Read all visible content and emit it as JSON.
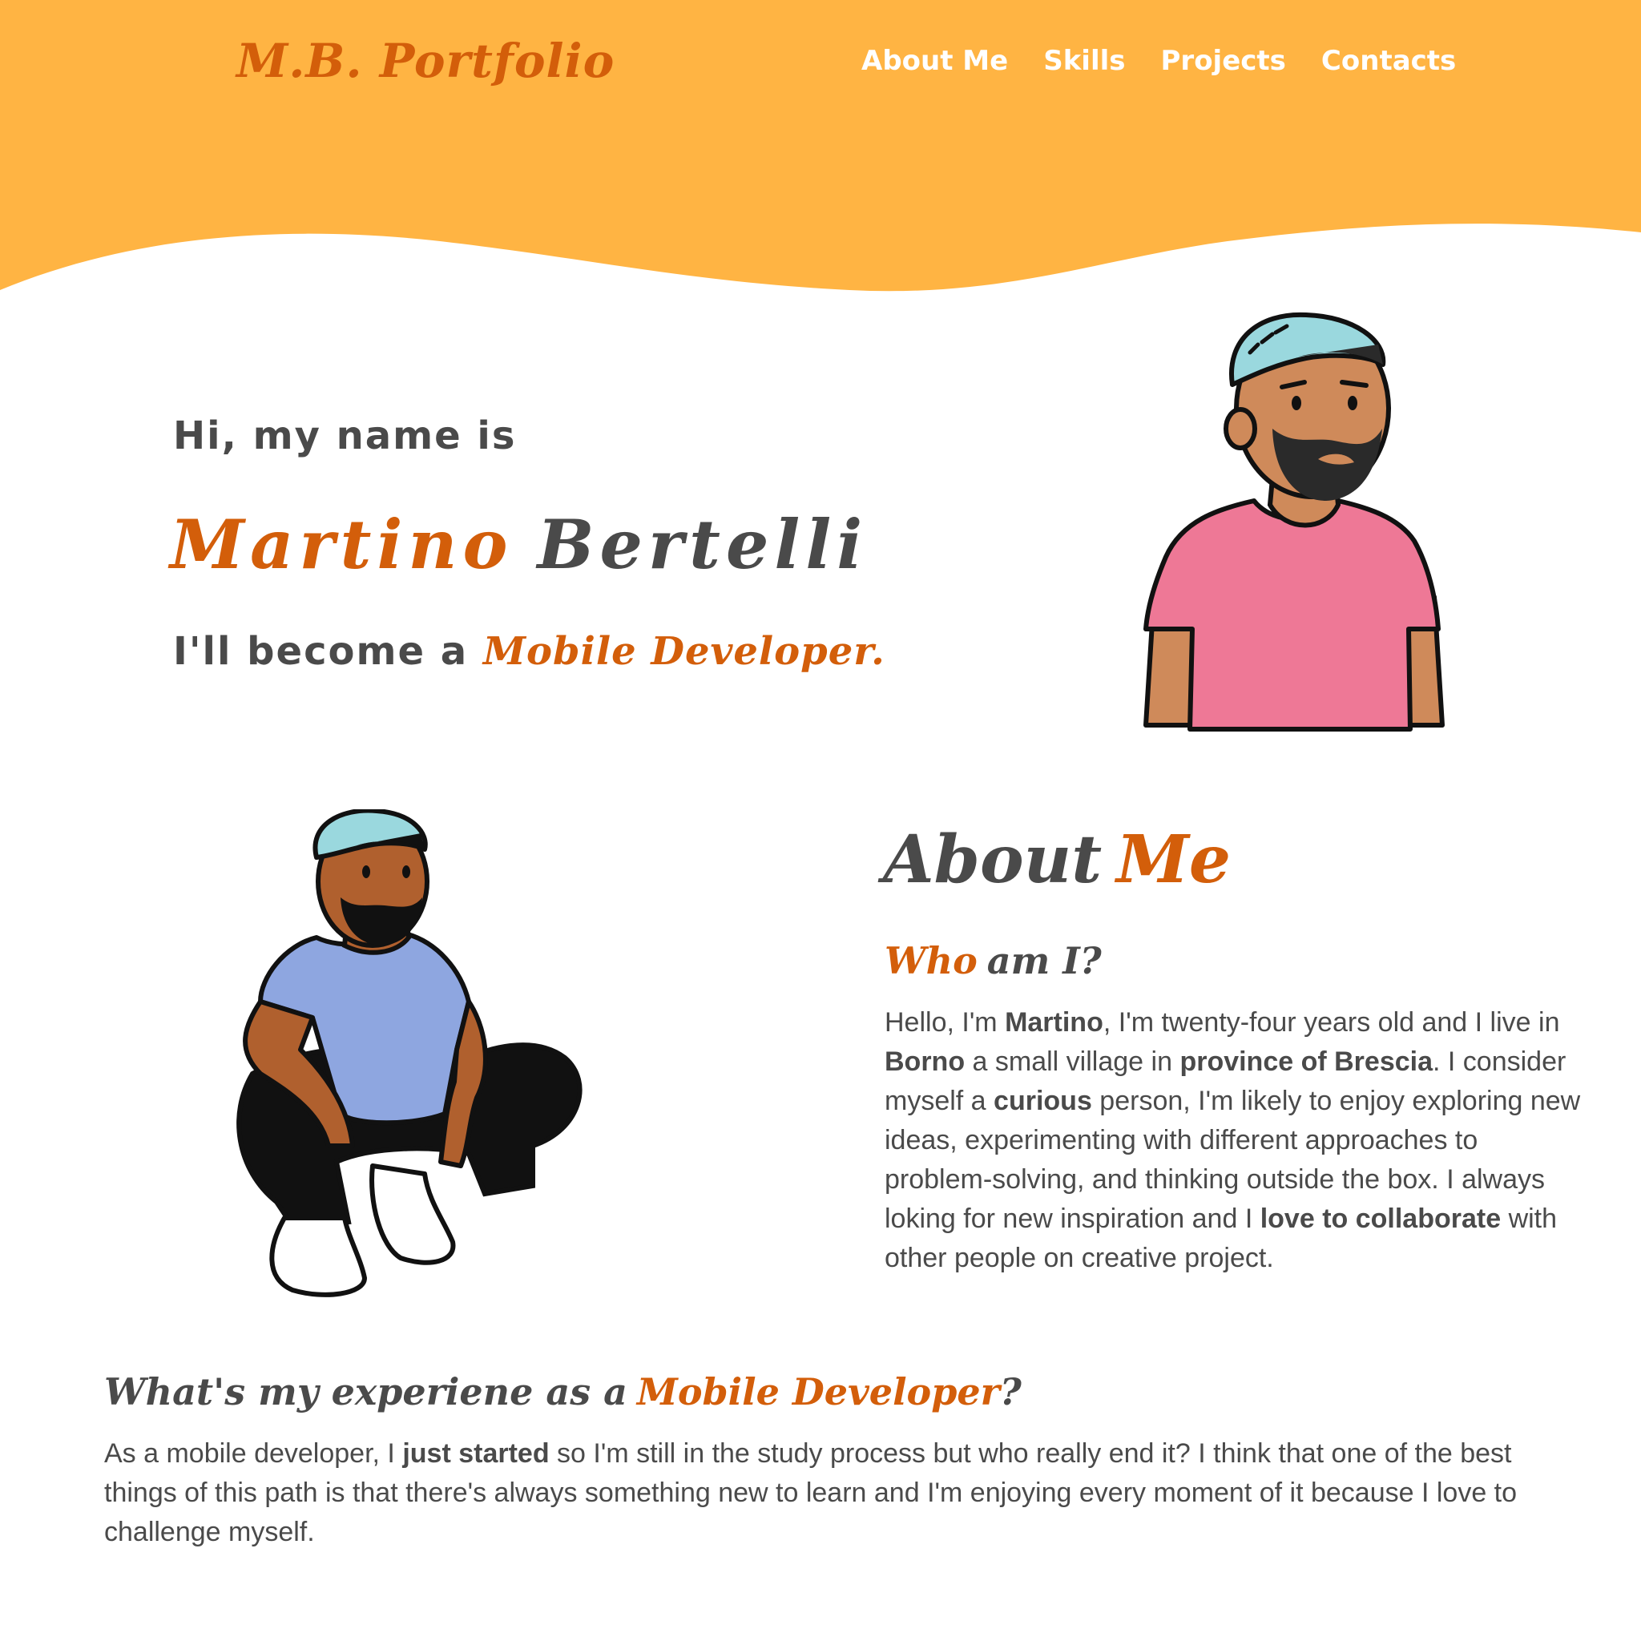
{
  "brand": {
    "logo": "M.B. Portfolio",
    "accent_color": "#d35e0a",
    "header_color": "#ffb443",
    "text_color": "#4a4a4a"
  },
  "nav": {
    "items": [
      {
        "label": "About Me"
      },
      {
        "label": "Skills"
      },
      {
        "label": "Projects"
      },
      {
        "label": "Contacts"
      }
    ]
  },
  "hero": {
    "greeting": "Hi, my name is",
    "first_name": "Martino",
    "last_name": "Bertelli",
    "tagline_prefix": "I'll become a",
    "tagline_role": "Mobile Developer."
  },
  "about": {
    "title_part1": "About",
    "title_part2": "Me",
    "who_part1": "Who",
    "who_part2": "am I?",
    "bio": [
      {
        "text": "Hello, I'm ",
        "bold": false
      },
      {
        "text": "Martino",
        "bold": true
      },
      {
        "text": ", I'm twenty-four years old and I live in ",
        "bold": false
      },
      {
        "text": "Borno",
        "bold": true
      },
      {
        "text": " a small village in ",
        "bold": false
      },
      {
        "text": "province of Brescia",
        "bold": true
      },
      {
        "text": ". I consider myself a ",
        "bold": false
      },
      {
        "text": "curious",
        "bold": true
      },
      {
        "text": " person, I'm likely to enjoy exploring new ideas, experimenting with different approaches to problem-solving, and thinking outside the box. I always loking for new inspiration and I ",
        "bold": false
      },
      {
        "text": "love to collaborate",
        "bold": true
      },
      {
        "text": " with other people on creative project.",
        "bold": false
      }
    ]
  },
  "experience": {
    "title_part1": "What's my experiene as a",
    "title_part2": "Mobile Developer",
    "title_part3": "?",
    "text": [
      {
        "text": "As a mobile developer, I ",
        "bold": false
      },
      {
        "text": "just started",
        "bold": true
      },
      {
        "text": " so I'm still in the study process but who really end it? I think that one of the best things of this path is that there's always something new to learn and I'm enjoying every moment of it because I love to challenge myself.",
        "bold": false
      }
    ]
  },
  "illustrations": {
    "hero": {
      "icon": "person-standing-illustration",
      "shirt_color": "#ee7896",
      "beanie_color": "#9ad8de",
      "skin_color": "#cf8a5a"
    },
    "about": {
      "icon": "person-crouching-illustration",
      "shirt_color": "#8ea6e0",
      "beanie_color": "#9ad8de",
      "skin_color": "#b0602e"
    }
  }
}
